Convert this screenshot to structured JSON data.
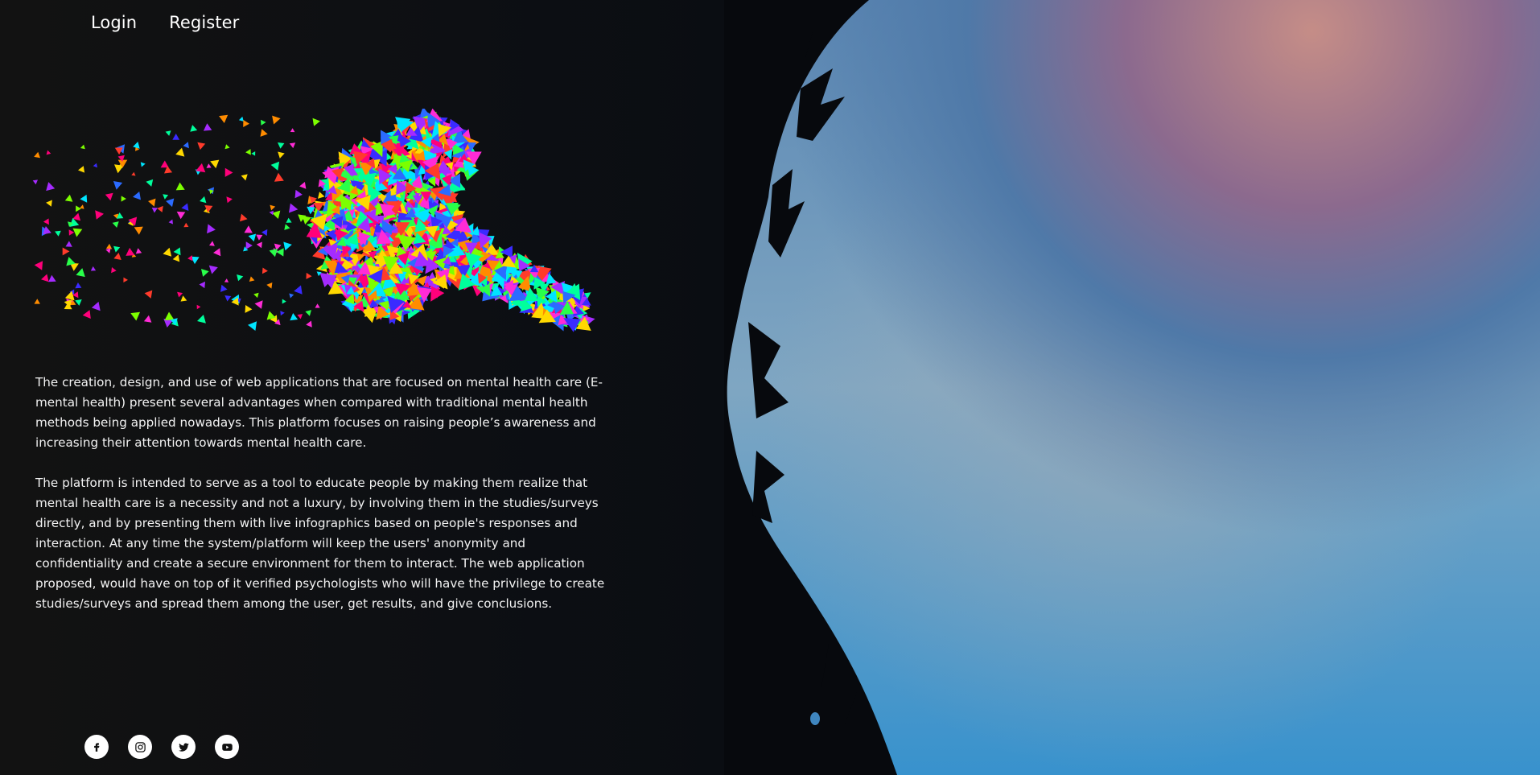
{
  "nav": {
    "login_label": "Login",
    "register_label": "Register"
  },
  "main": {
    "paragraphs": [
      "The creation, design, and use of web applications that are focused on mental health care (E-mental health) present several advantages when compared with traditional mental health methods being applied nowadays. This platform focuses on raising people’s awareness and increasing their attention towards mental health care.",
      "The platform is intended to serve as a tool to educate people by making them realize that mental health care is a necessity and not a luxury, by involving them in the studies/surveys directly, and by presenting them with live infographics based on people's responses and interaction. At any time the system/platform will keep the users' anonymity and confidentiality and create a secure environment for them to interact. The web application proposed, would have on top of it verified psychologists who will have the privilege to create studies/surveys and spread them among the user, get results, and give conclusions."
    ]
  },
  "socials": [
    {
      "icon": "facebook-icon"
    },
    {
      "icon": "instagram-icon"
    },
    {
      "icon": "twitter-icon"
    },
    {
      "icon": "youtube-icon"
    }
  ],
  "colors": {
    "background": "#0b0d11",
    "text": "#f2f2f2",
    "hero_blue": "#3a8fc8",
    "hero_pink": "#c08a88"
  }
}
